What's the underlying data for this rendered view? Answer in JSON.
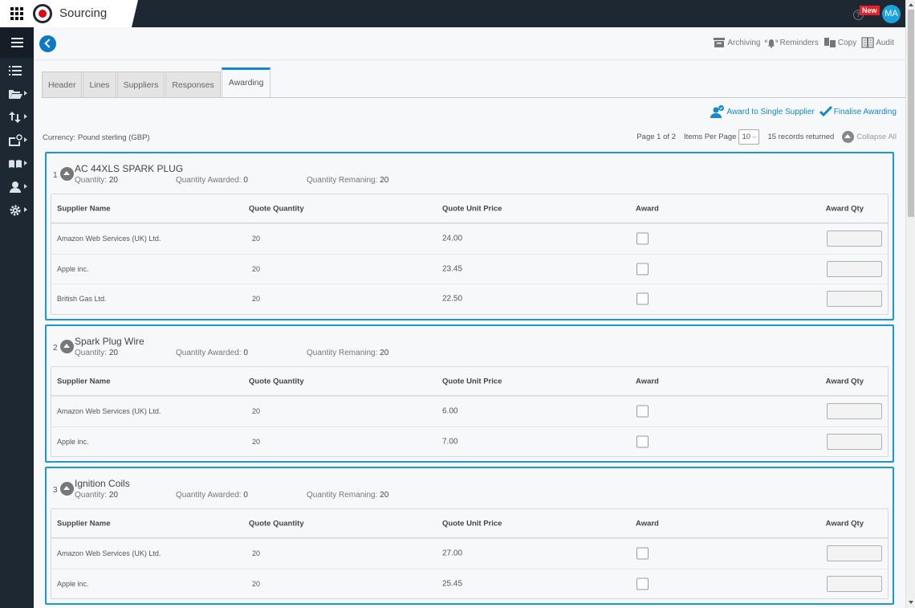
{
  "app": {
    "title": "Sourcing",
    "new_badge": "New",
    "user_initials": "MA",
    "accent": "#1687c9",
    "brand_red": "#e20613"
  },
  "toolbar": {
    "archiving": "Archiving",
    "reminders": "Reminders",
    "copy": "Copy",
    "audit": "Audit"
  },
  "sidenav": {
    "items": [
      {
        "icon": "list-icon"
      },
      {
        "icon": "folder-open-icon"
      },
      {
        "icon": "transfer-arrows-icon"
      },
      {
        "icon": "inbox-settings-icon"
      },
      {
        "icon": "book-icon"
      },
      {
        "icon": "user-icon"
      },
      {
        "icon": "gear-icon"
      }
    ]
  },
  "tabs": [
    {
      "label": "Header",
      "active": false
    },
    {
      "label": "Lines",
      "active": false
    },
    {
      "label": "Suppliers",
      "active": false
    },
    {
      "label": "Responses",
      "active": false
    },
    {
      "label": "Awarding",
      "active": true
    }
  ],
  "actions": {
    "award_single": "Award to Single Supplier",
    "finalise": "Finalise Awarding"
  },
  "currency": "Currency: Pound sterling (GBP)",
  "pager": {
    "page": "Page 1 of 2",
    "items_per_page_label": "Items Per Page",
    "items_per_page": "10",
    "records": "15 records returned",
    "collapse_all": "Collapse All"
  },
  "columns": {
    "supplier": "Supplier Name",
    "quote_qty": "Quote Quantity",
    "unit_price": "Quote Unit Price",
    "award": "Award",
    "award_qty": "Award Qty"
  },
  "meta_labels": {
    "quantity": "Quantity:",
    "awarded": "Quantity Awarded:",
    "remaining": "Quantity Remaning:"
  },
  "lines": [
    {
      "num": "1",
      "title": "AC 44XLS SPARK PLUG",
      "quantity": "20",
      "awarded": "0",
      "remaining": "20",
      "quotes": [
        {
          "supplier": "Amazon Web Services (UK) Ltd.",
          "qty": "20",
          "price": "24.00",
          "award": false,
          "award_qty": ""
        },
        {
          "supplier": "Apple inc.",
          "qty": "20",
          "price": "23.45",
          "award": false,
          "award_qty": ""
        },
        {
          "supplier": "British Gas Ltd.",
          "qty": "20",
          "price": "22.50",
          "award": false,
          "award_qty": ""
        }
      ]
    },
    {
      "num": "2",
      "title": "Spark Plug Wire",
      "quantity": "20",
      "awarded": "0",
      "remaining": "20",
      "quotes": [
        {
          "supplier": "Amazon Web Services (UK) Ltd.",
          "qty": "20",
          "price": "6.00",
          "award": false,
          "award_qty": ""
        },
        {
          "supplier": "Apple inc.",
          "qty": "20",
          "price": "7.00",
          "award": false,
          "award_qty": ""
        }
      ]
    },
    {
      "num": "3",
      "title": "Ignition Coils",
      "quantity": "20",
      "awarded": "0",
      "remaining": "20",
      "quotes": [
        {
          "supplier": "Amazon Web Services (UK) Ltd.",
          "qty": "20",
          "price": "27.00",
          "award": false,
          "award_qty": ""
        },
        {
          "supplier": "Apple inc.",
          "qty": "20",
          "price": "25.45",
          "award": false,
          "award_qty": ""
        }
      ]
    }
  ]
}
